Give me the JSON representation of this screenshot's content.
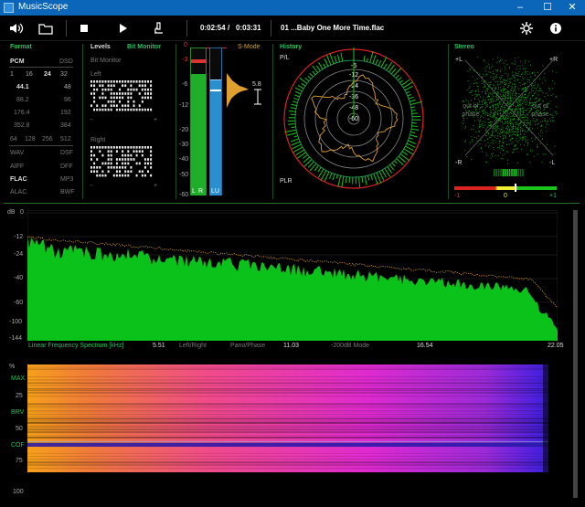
{
  "window": {
    "title": "MusicScope",
    "minimize": "–",
    "maximize": "☐",
    "close": "✕"
  },
  "toolbar": {
    "elapsed": "0:02:54",
    "slash": "/",
    "total": "0:03:31",
    "track": "01 ...Baby One More Time.flac"
  },
  "format": {
    "title": "Format",
    "pcm": "PCM",
    "dsd": "DSD",
    "bits": [
      "1",
      "16",
      "24",
      "32"
    ],
    "khz": "kHz",
    "rates": [
      [
        "44.1",
        "48"
      ],
      [
        "88.2",
        "96"
      ],
      [
        "176.4",
        "192"
      ],
      [
        "352.8",
        "384"
      ]
    ],
    "dsd_rates": [
      "64",
      "128",
      "256",
      "512"
    ],
    "types": [
      [
        "WAV",
        "DSF"
      ],
      [
        "AIFF",
        "DFF"
      ],
      [
        "FLAC",
        "MP3"
      ],
      [
        "ALAC",
        "BWF"
      ]
    ]
  },
  "levels": {
    "title": "Levels",
    "bit_monitor": "Bit Monitor",
    "sub_title": "Bit Monitor",
    "left": "Left",
    "right": "Right",
    "minus": "-",
    "plus": "+",
    "scale": [
      "0",
      "-3",
      "-6",
      "-12",
      "-20",
      "-30",
      "-40",
      "-50",
      "-60"
    ],
    "ch_labels": [
      "L",
      "R",
      "LU"
    ],
    "smode": "S-Mode",
    "readout": "5.8",
    "lr_level": 0.82,
    "lu_level": 0.78
  },
  "history": {
    "title": "History",
    "pl": "P/L",
    "plr": "PLR",
    "rings": [
      "-6",
      "-12",
      "-24",
      "-36",
      "-48",
      "-60"
    ]
  },
  "stereo": {
    "title": "Stereo",
    "pl": "+L",
    "pr": "+R",
    "ml": "-L",
    "mr": "-R",
    "out_phase_l": "out of phase",
    "out_phase_r": "out of phase",
    "bal_min": "-1",
    "bal_mid": "0",
    "bal_max": "+1",
    "balance": 0.18
  },
  "spectrum": {
    "db_unit": "dB",
    "db_ticks": [
      "0",
      "-12",
      "-24",
      "-40",
      "-60",
      "-100",
      "-144"
    ],
    "freq_ticks": [
      "5.51",
      "11.03",
      "16.54",
      "22.05"
    ],
    "caption": "Linear Frequency Spectrum [kHz]",
    "modes": [
      "Left/Right",
      "Pano/Phase",
      "-200dB Mode"
    ]
  },
  "spectrogram": {
    "pct": "%",
    "ticks": [
      "MAX",
      "25",
      "BRV",
      "50",
      "COF",
      "75",
      "100"
    ]
  },
  "colors": {
    "accent_green": "#22c55e",
    "ochre": "#e0a030",
    "spectrum": "#0ac21a",
    "meter_blue": "#2a8fcf",
    "titlebar": "#0b65b8"
  }
}
